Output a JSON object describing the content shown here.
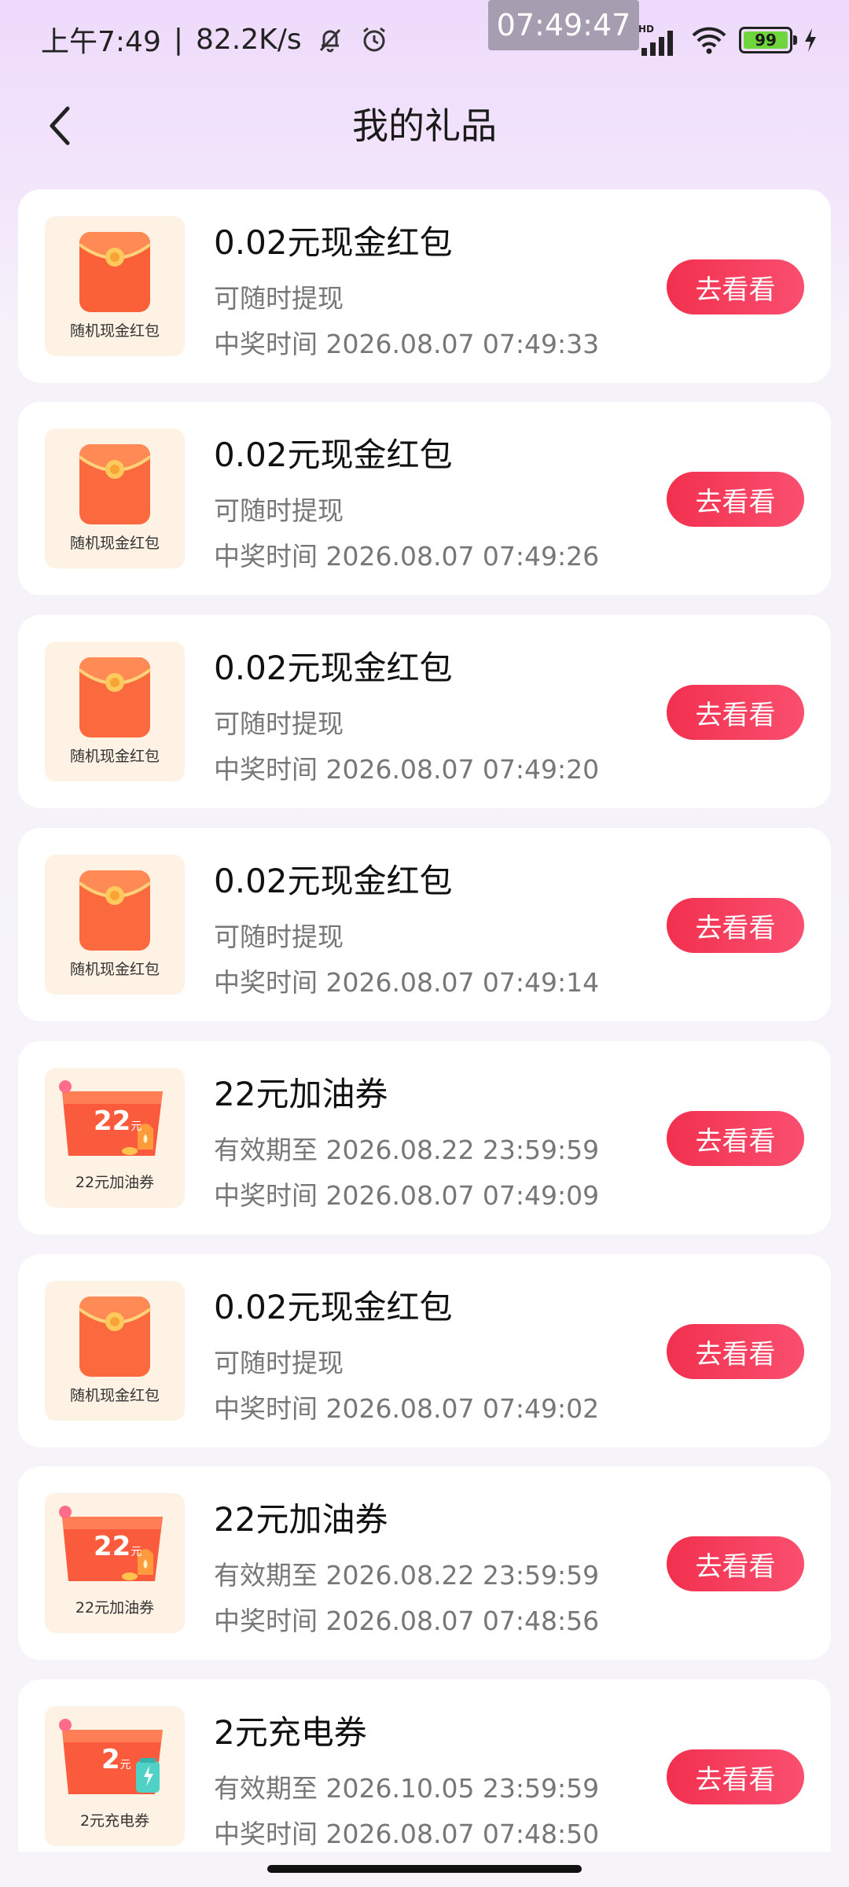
{
  "status_bar": {
    "time_left": "上午7:49",
    "net_speed": "82.2K/s",
    "clock_chip": "07:49:47",
    "hd_label": "HD",
    "battery": "99",
    "icons": [
      "mute-bell-icon",
      "alarm-icon",
      "signal-icon",
      "wifi-icon",
      "battery-icon",
      "charging-icon"
    ]
  },
  "header": {
    "title": "我的礼品",
    "back_icon": "chevron-left-icon"
  },
  "colors": {
    "accent": "#f2304e",
    "accent_end": "#fa4f70",
    "thumb_bg": "#fdf2e4"
  },
  "items": [
    {
      "kind": "red-packet",
      "thumb_label": "随机现金红包",
      "title": "0.02元现金红包",
      "sub": "可随时提现",
      "time": "中奖时间 2026.08.07 07:49:33",
      "button": "去看看"
    },
    {
      "kind": "red-packet",
      "thumb_label": "随机现金红包",
      "title": "0.02元现金红包",
      "sub": "可随时提现",
      "time": "中奖时间 2026.08.07 07:49:26",
      "button": "去看看"
    },
    {
      "kind": "red-packet",
      "thumb_label": "随机现金红包",
      "title": "0.02元现金红包",
      "sub": "可随时提现",
      "time": "中奖时间 2026.08.07 07:49:20",
      "button": "去看看"
    },
    {
      "kind": "red-packet",
      "thumb_label": "随机现金红包",
      "title": "0.02元现金红包",
      "sub": "可随时提现",
      "time": "中奖时间 2026.08.07 07:49:14",
      "button": "去看看"
    },
    {
      "kind": "fuel-coupon",
      "thumb_label": "22元加油券",
      "amount": "22",
      "unit": "元",
      "title": "22元加油券",
      "sub": "有效期至 2026.08.22 23:59:59",
      "time": "中奖时间 2026.08.07 07:49:09",
      "button": "去看看"
    },
    {
      "kind": "red-packet",
      "thumb_label": "随机现金红包",
      "title": "0.02元现金红包",
      "sub": "可随时提现",
      "time": "中奖时间 2026.08.07 07:49:02",
      "button": "去看看"
    },
    {
      "kind": "fuel-coupon",
      "thumb_label": "22元加油券",
      "amount": "22",
      "unit": "元",
      "title": "22元加油券",
      "sub": "有效期至 2026.08.22 23:59:59",
      "time": "中奖时间 2026.08.07 07:48:56",
      "button": "去看看"
    },
    {
      "kind": "charge-coupon",
      "thumb_label": "2元充电券",
      "amount": "2",
      "unit": "元",
      "title": "2元充电券",
      "sub": "有效期至 2026.10.05 23:59:59",
      "time": "中奖时间 2026.08.07 07:48:50",
      "button": "去看看"
    }
  ]
}
